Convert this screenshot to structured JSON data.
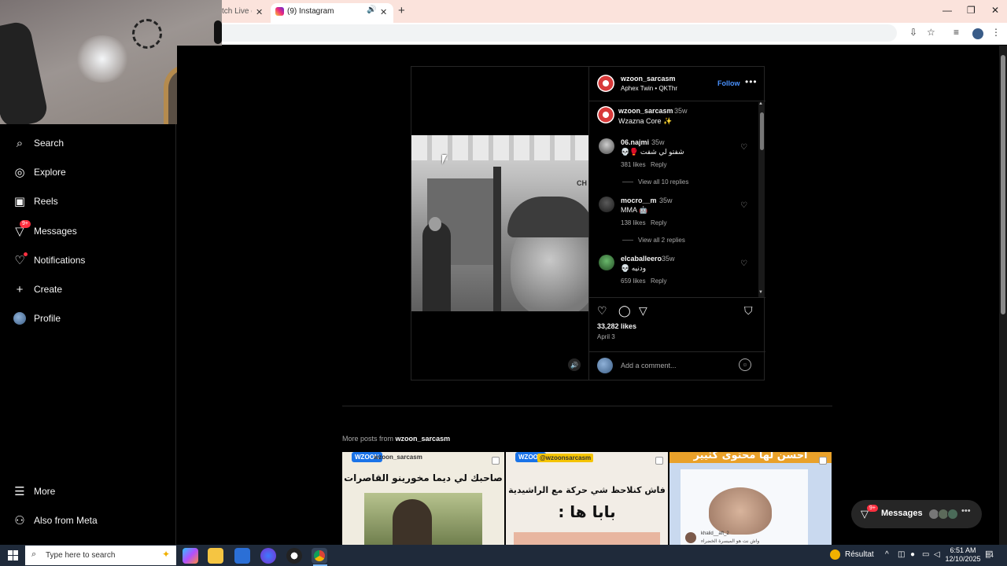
{
  "browser": {
    "tab_prev_label": "tch Live cr",
    "tab_active_label": "(9) Instagram",
    "new_tab": "+",
    "close_glyph": "✕",
    "minimize_glyph": "—",
    "restore_glyph": "❐"
  },
  "sidebar": {
    "items": [
      {
        "label": "Search",
        "icon": "search-icon"
      },
      {
        "label": "Explore",
        "icon": "compass-icon"
      },
      {
        "label": "Reels",
        "icon": "reels-icon"
      },
      {
        "label": "Messages",
        "icon": "messenger-icon",
        "badge": "9+"
      },
      {
        "label": "Notifications",
        "icon": "heart-icon"
      },
      {
        "label": "Create",
        "icon": "plus-icon"
      },
      {
        "label": "Profile",
        "icon": "avatar"
      }
    ],
    "bottom": [
      {
        "label": "More",
        "icon": "menu-icon"
      },
      {
        "label": "Also from Meta",
        "icon": "meta-apps-icon"
      }
    ]
  },
  "post": {
    "username": "wzoon_sarcasm",
    "audio": "Aphex Twin • QKThr",
    "follow_label": "Follow",
    "more_glyph": "•••",
    "caption_user": "wzoon_sarcasm",
    "caption_time": "35w",
    "caption_text": "Wzazna Core ✨",
    "comments": [
      {
        "user": "06.najmi",
        "time": "35w",
        "text": "💀🥊 شفتو لي شفت",
        "likes": "381 likes",
        "reply": "Reply",
        "view_replies": "View all 10 replies"
      },
      {
        "user": "mocro__m",
        "time": "35w",
        "text": "MMA 🤖",
        "likes": "138 likes",
        "reply": "Reply",
        "view_replies": "View all 2 replies"
      },
      {
        "user": "elcaballeero",
        "time": "35w",
        "text": "💀 ودنيه",
        "likes": "659 likes",
        "reply": "Reply",
        "view_replies": ""
      }
    ],
    "likes_count": "33,282 likes",
    "date": "April 3",
    "add_comment_placeholder": "Add a comment...",
    "photo_sign": "CH"
  },
  "more_posts": {
    "prefix": "More posts from",
    "username": "wzoon_sarcasm",
    "tiles": [
      {
        "logo": "WZOON",
        "handle": "wzoon_sarcasm",
        "text": "صاحبك لي ديما مخورينو القاصرات"
      },
      {
        "logo": "WZOON",
        "handle": "@wzoonsarcasm",
        "text": "فاش كنلاحظ شي حركة مع الراشيدية",
        "text2": "بابا ها :"
      },
      {
        "banner": "احسن لها محتوى كثيير",
        "commenter": "khalid__aft_2",
        "comment": "واش نت هو الميسرة الخضراء"
      }
    ]
  },
  "messages_pill": {
    "label": "Messages",
    "badge": "9+",
    "more": "•••"
  },
  "taskbar": {
    "search_placeholder": "Type here to search",
    "weather_label": "Résultat",
    "time": "6:51 AM",
    "date": "12/10/2025",
    "notif_count": "4"
  }
}
